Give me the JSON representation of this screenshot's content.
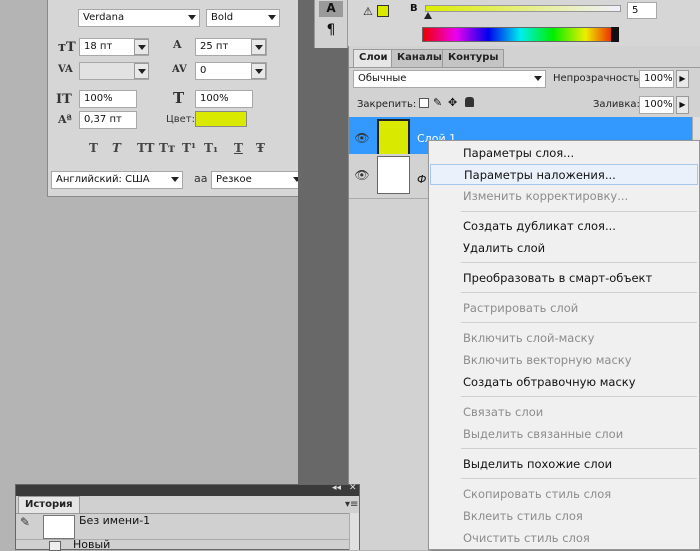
{
  "colors": {
    "accent": "#d9ea00",
    "highlight": "#3399ff"
  },
  "character": {
    "font_family": "Verdana",
    "font_style": "Bold",
    "size": "18 пт",
    "leading": "25 пт",
    "tracking": "0",
    "vscale": "100%",
    "hscale": "100%",
    "baseline": "0,37 пт",
    "color_label": "Цвет:",
    "color": "#d9ea00",
    "language": "Английский: США",
    "aa_icon": "aa",
    "antialias": "Резкое",
    "style_buttons": [
      "T",
      "T",
      "TT",
      "Tт",
      "T¹",
      "T₁",
      "T",
      "Ŧ"
    ]
  },
  "color_panel": {
    "channel": "B",
    "value": "5",
    "swatch": "#d9ea00"
  },
  "tool_dock": {
    "char_icon": "A",
    "para_icon": "¶"
  },
  "layers": {
    "tabs": [
      "Слои",
      "Каналы",
      "Контуры"
    ],
    "blend_mode": "Обычные",
    "opacity_label": "Непрозрачность:",
    "opacity": "100%",
    "lock_label": "Закрепить:",
    "fill_label": "Заливка:",
    "fill": "100%",
    "items": [
      {
        "name": "Слой 1",
        "color": "#d9ea00"
      },
      {
        "name": "Ф",
        "color": "#ffffff"
      }
    ]
  },
  "context_menu": {
    "items": [
      {
        "label": "Параметры слоя...",
        "state": "enabled"
      },
      {
        "label": "Параметры наложения...",
        "state": "highlighted"
      },
      {
        "label": "Изменить корректировку...",
        "state": "disabled"
      },
      {
        "label": "Создать дубликат слоя...",
        "state": "enabled"
      },
      {
        "label": "Удалить слой",
        "state": "enabled"
      },
      {
        "label": "Преобразовать в смарт-объект",
        "state": "enabled"
      },
      {
        "label": "Растрировать слой",
        "state": "disabled"
      },
      {
        "label": "Включить слой-маску",
        "state": "disabled"
      },
      {
        "label": "Включить векторную маску",
        "state": "disabled"
      },
      {
        "label": "Создать обтравочную маску",
        "state": "enabled"
      },
      {
        "label": "Связать слои",
        "state": "disabled"
      },
      {
        "label": "Выделить связанные слои",
        "state": "disabled"
      },
      {
        "label": "Выделить похожие слои",
        "state": "enabled"
      },
      {
        "label": "Скопировать стиль слоя",
        "state": "disabled"
      },
      {
        "label": "Вклеить стиль слоя",
        "state": "disabled"
      },
      {
        "label": "Очистить стиль слоя",
        "state": "disabled"
      }
    ]
  },
  "history": {
    "tab": "История",
    "items": [
      {
        "label": "Без имени-1"
      },
      {
        "label": "Новый"
      }
    ]
  }
}
